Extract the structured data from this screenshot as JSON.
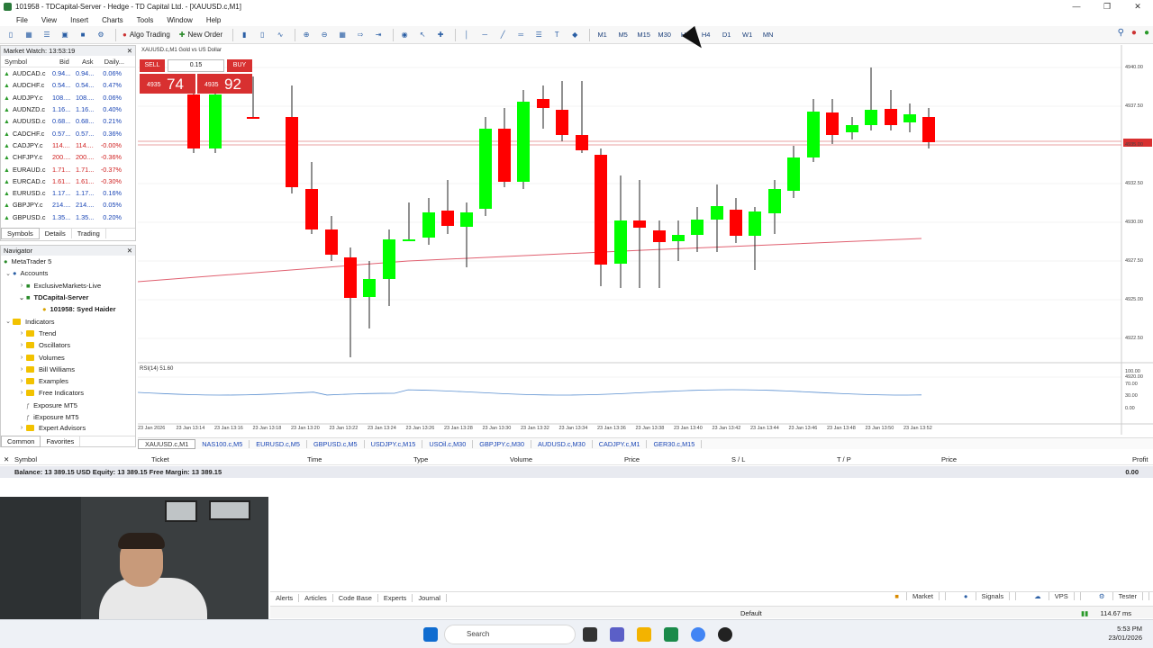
{
  "window": {
    "title": "101958 - TDCapital-Server - Hedge - TD Capital Ltd. - [XAUUSD.c,M1]"
  },
  "menu": [
    "File",
    "View",
    "Insert",
    "Charts",
    "Tools",
    "Window",
    "Help"
  ],
  "toolbar": {
    "time": "13:53:19",
    "algo_trading": "Algo Trading",
    "new_order": "New Order",
    "timeframes": [
      "M1",
      "M5",
      "M15",
      "M30",
      "H1",
      "H4",
      "D1",
      "W1",
      "MN"
    ]
  },
  "market_watch": {
    "title": "Market Watch: 13:53:19",
    "headers": [
      "Symbol",
      "Bid",
      "Ask",
      "Daily..."
    ],
    "rows": [
      {
        "symbol": "AUDCAD.c",
        "bid": "0.94...",
        "ask": "0.94...",
        "change": "0.06%"
      },
      {
        "symbol": "AUDCHF.c",
        "bid": "0.54...",
        "ask": "0.54...",
        "change": "0.47%"
      },
      {
        "symbol": "AUDJPY.c",
        "bid": "108....",
        "ask": "108....",
        "change": "0.06%"
      },
      {
        "symbol": "AUDNZD.c",
        "bid": "1.16...",
        "ask": "1.16...",
        "change": "0.40%"
      },
      {
        "symbol": "AUDUSD.c",
        "bid": "0.68...",
        "ask": "0.68...",
        "change": "0.21%"
      },
      {
        "symbol": "CADCHF.c",
        "bid": "0.57...",
        "ask": "0.57...",
        "change": "0.36%"
      },
      {
        "symbol": "CADJPY.c",
        "bid": "114....",
        "ask": "114....",
        "change": "-0.00%"
      },
      {
        "symbol": "CHFJPY.c",
        "bid": "200....",
        "ask": "200....",
        "change": "-0.36%"
      },
      {
        "symbol": "EURAUD.c",
        "bid": "1.71...",
        "ask": "1.71...",
        "change": "-0.37%"
      },
      {
        "symbol": "EURCAD.c",
        "bid": "1.61...",
        "ask": "1.61...",
        "change": "-0.30%"
      },
      {
        "symbol": "EURUSD.c",
        "bid": "1.17...",
        "ask": "1.17...",
        "change": "0.16%"
      },
      {
        "symbol": "GBPJPY.c",
        "bid": "214....",
        "ask": "214....",
        "change": "0.05%"
      },
      {
        "symbol": "GBPUSD.c",
        "bid": "1.35...",
        "ask": "1.35...",
        "change": "0.20%"
      }
    ],
    "tabs": [
      "Symbols",
      "Details",
      "Trading"
    ]
  },
  "navigator": {
    "title": "Navigator",
    "items": [
      "MetaTrader 5",
      "Accounts",
      "ExclusiveMarkets-Live",
      "TDCapital-Server",
      "101958: Syed Haider",
      "Indicators",
      "Trend",
      "Oscillators",
      "Volumes",
      "Bill Williams",
      "Examples",
      "Free Indicators",
      "Exposure MT5",
      "iExposure MT5",
      "Expert Advisors"
    ],
    "tabs": [
      "Common",
      "Favorites"
    ]
  },
  "chart": {
    "header": "XAUUSD.c,M1  Gold vs US Dollar",
    "sell_label": "SELL",
    "buy_label": "BUY",
    "lot": "0.15",
    "bid_small": "4935",
    "bid_big": "74",
    "ask_small": "4935",
    "ask_big": "92",
    "indicator_label": "RSI(14) 51.60",
    "price_axis": [
      "4940.00",
      "4937.50",
      "4935.00",
      "4932.50",
      "4930.00",
      "4927.50",
      "4925.00",
      "4922.50",
      "4920.00"
    ],
    "rsi_axis": [
      "100.00",
      "70.00",
      "30.00",
      "0.00"
    ],
    "time_axis": [
      "23 Jan 2026",
      "23 Jan 13:14",
      "23 Jan 13:16",
      "23 Jan 13:18",
      "23 Jan 13:20",
      "23 Jan 13:22",
      "23 Jan 13:24",
      "23 Jan 13:26",
      "23 Jan 13:28",
      "23 Jan 13:30",
      "23 Jan 13:32",
      "23 Jan 13:34",
      "23 Jan 13:36",
      "23 Jan 13:38",
      "23 Jan 13:40",
      "23 Jan 13:42",
      "23 Jan 13:44",
      "23 Jan 13:46",
      "23 Jan 13:48",
      "23 Jan 13:50",
      "23 Jan 13:52"
    ],
    "symbol_tabs": [
      "XAUUSD.c,M1",
      "NAS100.c,M5",
      "EURUSD.c,M5",
      "GBPUSD.c,M5",
      "USDJPY.c,M15",
      "USOil.c,M30",
      "GBPJPY.c,M30",
      "AUDUSD.c,M30",
      "CADJPY.c,M1",
      "GER30.c,M15"
    ]
  },
  "toolbox": {
    "headers": [
      "Symbol",
      "Ticket",
      "Time",
      "Type",
      "Volume",
      "Price",
      "S / L",
      "T / P",
      "Price",
      "Profit"
    ],
    "balance": "Balance: 13 389.15 USD  Equity: 13 389.15  Free Margin: 13 389.15",
    "profit": "0.00",
    "tabs": [
      "Alerts",
      "Articles",
      "Code Base",
      "Experts",
      "Journal"
    ],
    "right_tabs": [
      "Market",
      "Signals",
      "VPS",
      "Tester"
    ]
  },
  "status": {
    "profile": "Default",
    "ping": "114.67 ms"
  },
  "taskbar": {
    "search": "Search",
    "time": "5:53 PM",
    "date": "23/01/2026"
  },
  "colors": {
    "bull": "#00ff00",
    "bear": "#ff0000",
    "ma": "#e06070",
    "rsi": "#5a8fd0"
  }
}
